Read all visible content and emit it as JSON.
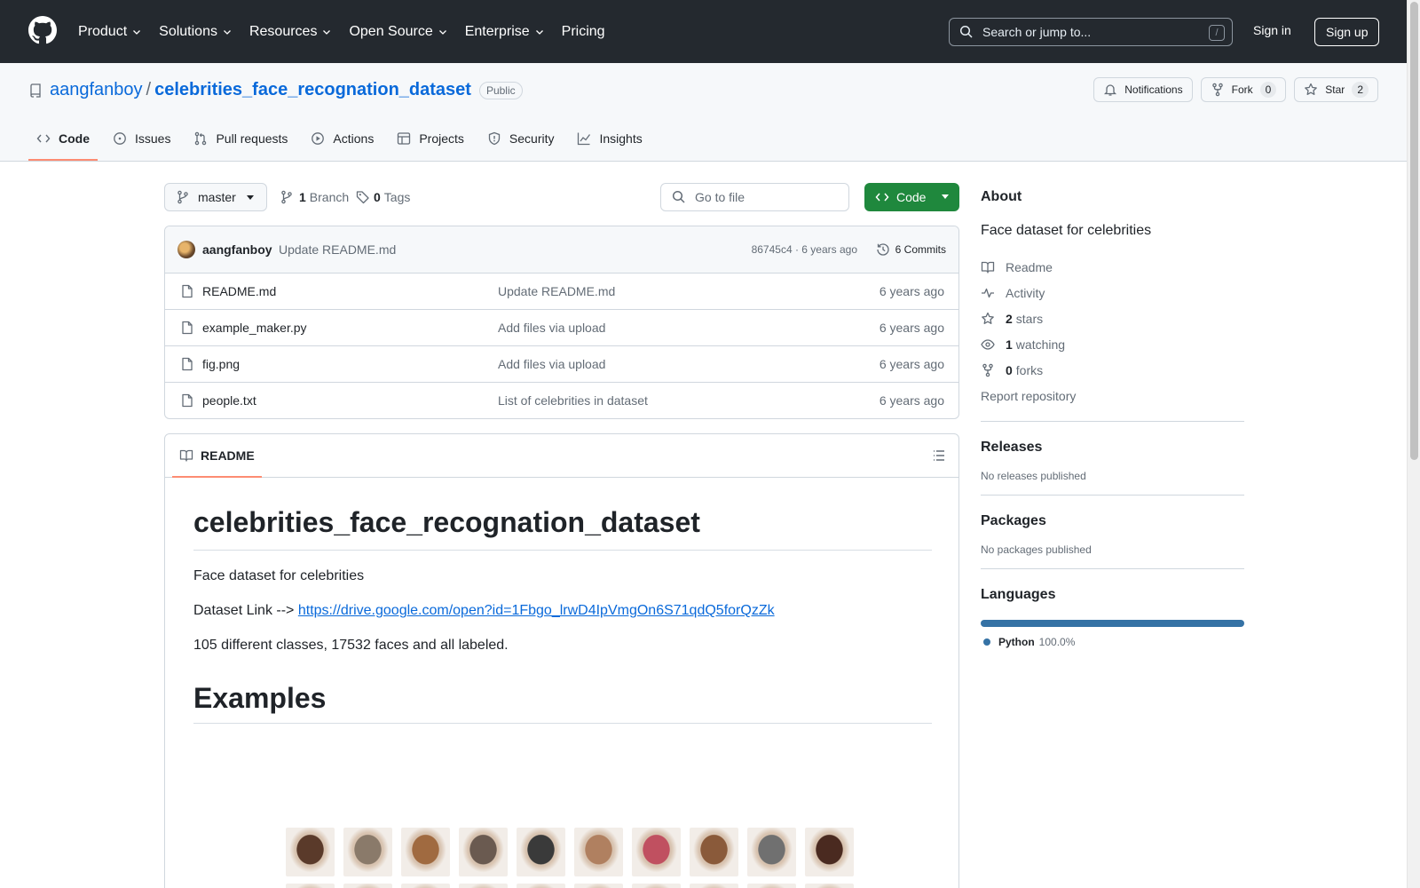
{
  "header": {
    "nav": [
      "Product",
      "Solutions",
      "Resources",
      "Open Source",
      "Enterprise",
      "Pricing"
    ],
    "search_placeholder": "Search or jump to...",
    "search_shortcut": "/",
    "signin": "Sign in",
    "signup": "Sign up"
  },
  "repo": {
    "owner": "aangfanboy",
    "separator": "/",
    "name": "celebrities_face_recognation_dataset",
    "visibility": "Public",
    "notifications": "Notifications",
    "fork_label": "Fork",
    "fork_count": "0",
    "star_label": "Star",
    "star_count": "2"
  },
  "tabs": [
    "Code",
    "Issues",
    "Pull requests",
    "Actions",
    "Projects",
    "Security",
    "Insights"
  ],
  "filenav": {
    "branch": "master",
    "branch_count": "1",
    "branch_label": "Branch",
    "tag_count": "0",
    "tag_label": "Tags",
    "goto_placeholder": "Go to file",
    "code_button": "Code"
  },
  "commit": {
    "author": "aangfanboy",
    "message": "Update README.md",
    "meta": "86745c4 · 6 years ago",
    "commits": "6 Commits"
  },
  "files": [
    {
      "name": "README.md",
      "message": "Update README.md",
      "time": "6 years ago"
    },
    {
      "name": "example_maker.py",
      "message": "Add files via upload",
      "time": "6 years ago"
    },
    {
      "name": "fig.png",
      "message": "Add files via upload",
      "time": "6 years ago"
    },
    {
      "name": "people.txt",
      "message": "List of celebrities in dataset",
      "time": "6 years ago"
    }
  ],
  "readme": {
    "tab": "README",
    "title": "celebrities_face_recognation_dataset",
    "desc": "Face dataset for celebrities",
    "link_prefix": "Dataset Link -->",
    "link": "https://drive.google.com/open?id=1Fbgo_lrwD4IpVmgOn6S71qdQ5forQzZk",
    "stats": "105 different classes, 17532 faces and all labeled.",
    "examples_heading": "Examples",
    "face_tones": [
      "#5a3a2a",
      "#8a7a6a",
      "#a06a40",
      "#6a5a50",
      "#3a3a3a",
      "#b08060",
      "#c05060",
      "#8a5a3a",
      "#707070",
      "#4a2a20"
    ]
  },
  "sidebar": {
    "about_title": "About",
    "about_desc": "Face dataset for celebrities",
    "readme": "Readme",
    "activity": "Activity",
    "stars_count": "2",
    "stars_label": "stars",
    "watching_count": "1",
    "watching_label": "watching",
    "forks_count": "0",
    "forks_label": "forks",
    "report": "Report repository",
    "releases_title": "Releases",
    "releases_sub": "No releases published",
    "packages_title": "Packages",
    "packages_sub": "No packages published",
    "languages_title": "Languages",
    "language": "Python",
    "language_pct": "100.0%",
    "language_color": "#3572A5"
  }
}
